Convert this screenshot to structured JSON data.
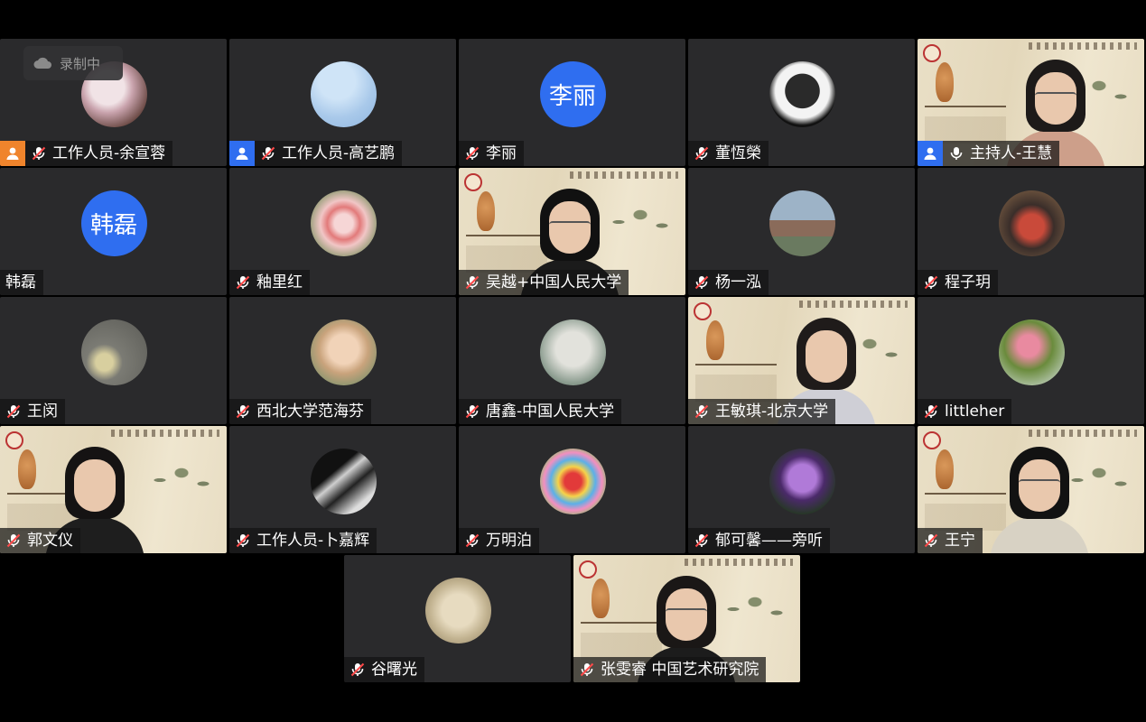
{
  "recording": {
    "label": "录制中",
    "icon": "cloud-icon"
  },
  "colors": {
    "tile_bg": "#2a2a2c",
    "staff_badge": "#f0842c",
    "user_badge": "#2f6ef0",
    "avatar_text_bg": "#2f6ef0",
    "label_bg": "rgba(20,20,20,0.72)"
  },
  "participants": [
    {
      "name": "工作人员-余宣蓉",
      "badge": "staff",
      "muted": true,
      "avatar": "photo"
    },
    {
      "name": "工作人员-高艺鹏",
      "badge": "user",
      "muted": true,
      "avatar": "photo"
    },
    {
      "name": "李丽",
      "badge": "none",
      "muted": true,
      "avatar": "text",
      "avatar_text": "李丽"
    },
    {
      "name": "董恆榮",
      "badge": "none",
      "muted": true,
      "avatar": "photo"
    },
    {
      "name": "主持人-王慧",
      "badge": "user",
      "muted": false,
      "avatar": "video"
    },
    {
      "name": "韩磊",
      "badge": "none",
      "muted": false,
      "avatar": "text",
      "avatar_text": "韩磊"
    },
    {
      "name": "釉里红",
      "badge": "none",
      "muted": true,
      "avatar": "photo"
    },
    {
      "name": "吴越+中国人民大学",
      "badge": "none",
      "muted": true,
      "avatar": "video"
    },
    {
      "name": "杨一泓",
      "badge": "none",
      "muted": true,
      "avatar": "photo"
    },
    {
      "name": "程子玥",
      "badge": "none",
      "muted": true,
      "avatar": "photo"
    },
    {
      "name": "王闵",
      "badge": "none",
      "muted": true,
      "avatar": "photo"
    },
    {
      "name": "西北大学范海芬",
      "badge": "none",
      "muted": true,
      "avatar": "photo"
    },
    {
      "name": "唐鑫-中国人民大学",
      "badge": "none",
      "muted": true,
      "avatar": "photo"
    },
    {
      "name": "王敏琪-北京大学",
      "badge": "none",
      "muted": true,
      "avatar": "video"
    },
    {
      "name": "littleher",
      "badge": "none",
      "muted": true,
      "avatar": "photo"
    },
    {
      "name": "郭文仪",
      "badge": "none",
      "muted": true,
      "avatar": "video"
    },
    {
      "name": "工作人员-卜嘉辉",
      "badge": "none",
      "muted": true,
      "avatar": "photo"
    },
    {
      "name": "万明泊",
      "badge": "none",
      "muted": true,
      "avatar": "photo"
    },
    {
      "name": "郁可馨——旁听",
      "badge": "none",
      "muted": true,
      "avatar": "photo"
    },
    {
      "name": "王宁",
      "badge": "none",
      "muted": true,
      "avatar": "video"
    },
    {
      "name": "谷曙光",
      "badge": "none",
      "muted": true,
      "avatar": "photo"
    },
    {
      "name": "张雯睿 中国艺术研究院",
      "badge": "none",
      "muted": true,
      "avatar": "video"
    }
  ]
}
